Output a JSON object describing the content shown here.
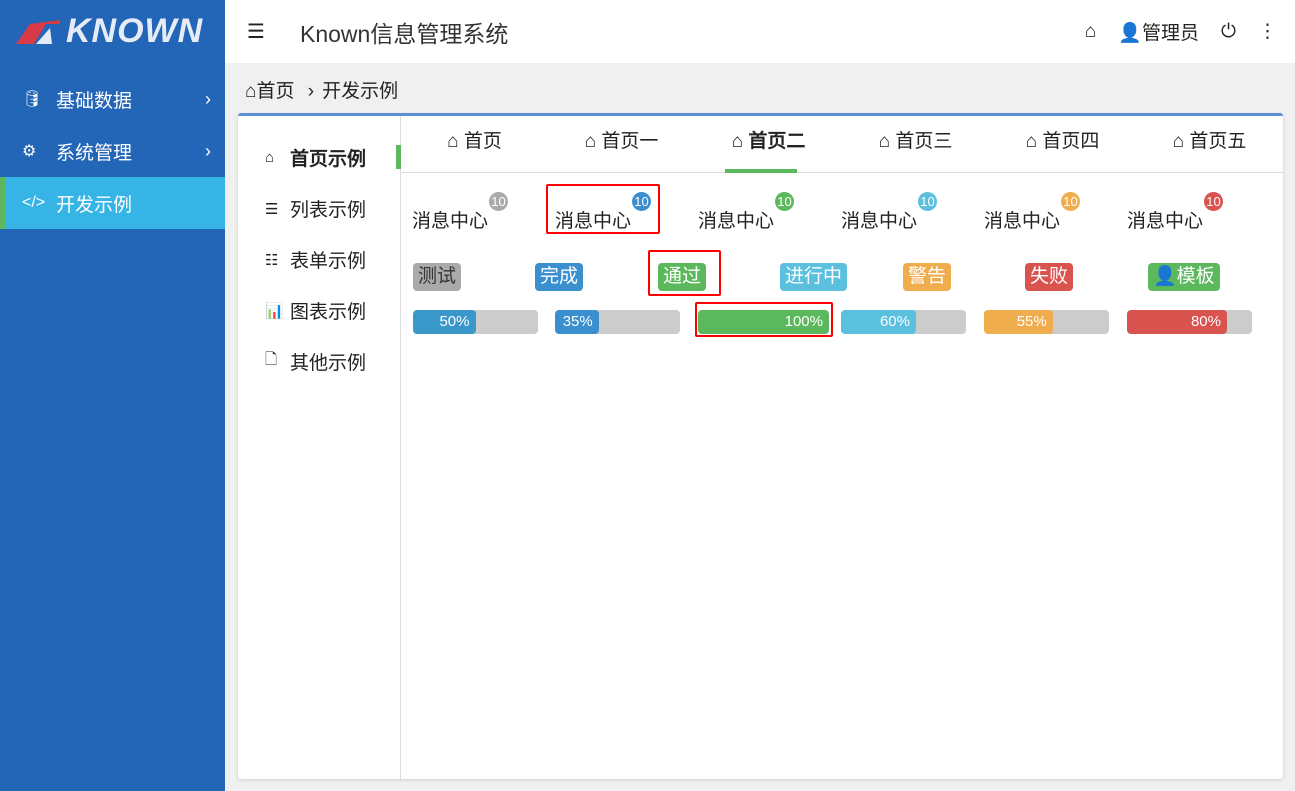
{
  "app": {
    "logo_text": "KNOWN",
    "title": "Known信息管理系统",
    "user": "管理员"
  },
  "sidebar": {
    "items": [
      {
        "label": "基础数据",
        "icon": "database-icon"
      },
      {
        "label": "系统管理",
        "icon": "cogs-icon"
      },
      {
        "label": "开发示例",
        "icon": "code-icon",
        "active": true
      }
    ]
  },
  "breadcrumb": {
    "home": "首页",
    "sep": "›",
    "current": "开发示例"
  },
  "left_menu": [
    {
      "label": "首页示例",
      "icon": "home-icon",
      "active": true
    },
    {
      "label": "列表示例",
      "icon": "list-icon"
    },
    {
      "label": "表单示例",
      "icon": "list-alt-icon"
    },
    {
      "label": "图表示例",
      "icon": "bar-chart-icon"
    },
    {
      "label": "其他示例",
      "icon": "file-icon"
    }
  ],
  "tabs": [
    {
      "label": "首页"
    },
    {
      "label": "首页一"
    },
    {
      "label": "首页二",
      "active": true
    },
    {
      "label": "首页三"
    },
    {
      "label": "首页四"
    },
    {
      "label": "首页五"
    }
  ],
  "messages": [
    {
      "label": "消息中心",
      "count": "10",
      "color": "#aaaaaa"
    },
    {
      "label": "消息中心",
      "count": "10",
      "color": "#3a8fcf"
    },
    {
      "label": "消息中心",
      "count": "10",
      "color": "#5cb85c"
    },
    {
      "label": "消息中心",
      "count": "10",
      "color": "#5bc0de"
    },
    {
      "label": "消息中心",
      "count": "10",
      "color": "#f0ad4e"
    },
    {
      "label": "消息中心",
      "count": "10",
      "color": "#d9534f"
    }
  ],
  "labels": [
    {
      "text": "测试",
      "color": "#aaaaaa"
    },
    {
      "text": "完成",
      "color": "#3a8fcf"
    },
    {
      "text": "通过",
      "color": "#5cb85c"
    },
    {
      "text": "进行中",
      "color": "#5bc0de"
    },
    {
      "text": "警告",
      "color": "#f0ad4e"
    },
    {
      "text": "失败",
      "color": "#d9534f"
    },
    {
      "text": "模板",
      "color": "#5cb85c",
      "icon": "user-icon"
    }
  ],
  "progress": [
    {
      "text": "50%",
      "value": 50,
      "color": "#3a97c9"
    },
    {
      "text": "35%",
      "value": 35,
      "color": "#3a8fcf"
    },
    {
      "text": "100%",
      "value": 100,
      "color": "#5cb85c"
    },
    {
      "text": "60%",
      "value": 60,
      "color": "#5bc0de"
    },
    {
      "text": "55%",
      "value": 55,
      "color": "#f0ad4e"
    },
    {
      "text": "80%",
      "value": 80,
      "color": "#d9534f"
    }
  ]
}
